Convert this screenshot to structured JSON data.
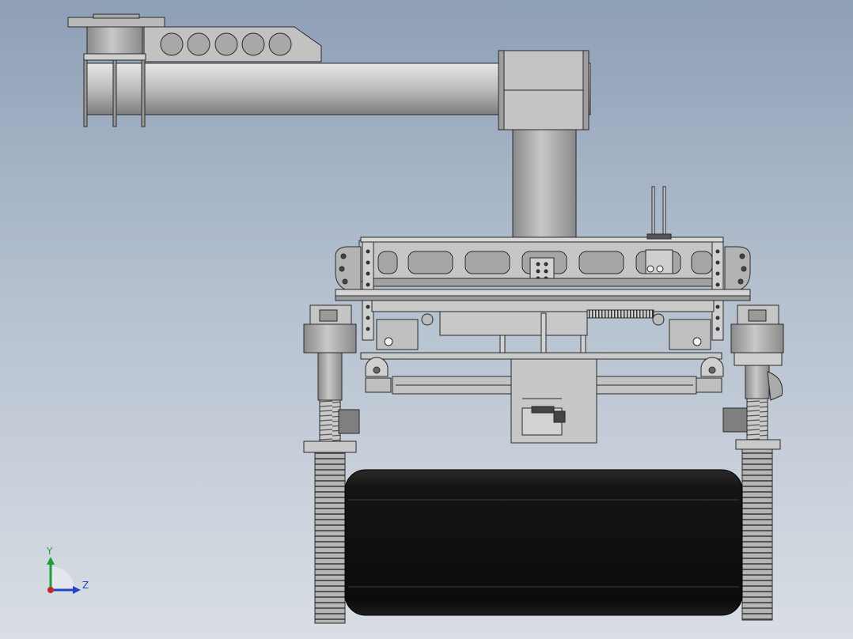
{
  "viewport": {
    "background_top": "#8e9fb6",
    "background_bottom": "#d9dee4"
  },
  "model": {
    "part_color": "#bdbdbd",
    "part_dark": "#8c8c8c",
    "edge_color": "#2a2a2a",
    "tire_color": "#121212"
  },
  "triad": {
    "y_label": "Y",
    "z_label": "Z",
    "y_color": "#1e9e3a",
    "z_color": "#2742c8",
    "x_color": "#c0262b"
  }
}
